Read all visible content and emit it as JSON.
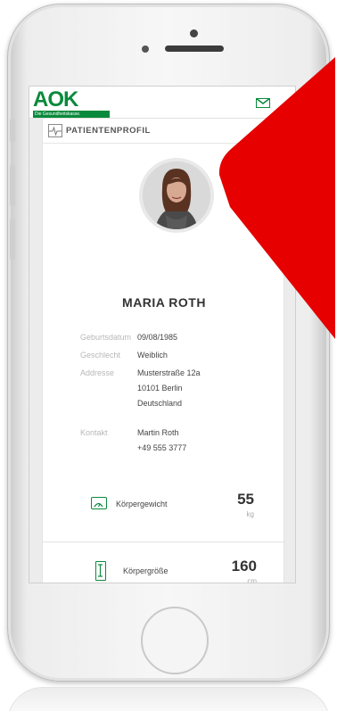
{
  "header": {
    "logo_text": "AOK",
    "logo_tagline": "Die Gesundheitskasse.",
    "mail_icon": "mail-icon"
  },
  "card": {
    "title": "PATIENTENPROFIL",
    "title_icon": "ekg-icon"
  },
  "patient": {
    "name": "MARIA ROTH",
    "fields": [
      {
        "label": "Geburtsdatum",
        "values": [
          "09/08/1985"
        ]
      },
      {
        "label": "Geschlecht",
        "values": [
          "Weiblich"
        ]
      },
      {
        "label": "Addresse",
        "values": [
          "Musterstraße 12a",
          "10101 Berlin",
          "Deutschland"
        ]
      },
      {
        "label": "Kontakt",
        "values": [
          "Martin Roth",
          "+49 555 3777"
        ]
      }
    ]
  },
  "metrics": [
    {
      "label": "Körpergewicht",
      "value": "55",
      "unit": "kg",
      "icon": "scale-icon"
    },
    {
      "label": "Körpergröße",
      "value": "160",
      "unit": "cm",
      "icon": "height-icon"
    }
  ],
  "colors": {
    "brand_green": "#0a8a3c",
    "overlay_red": "#e60000"
  }
}
